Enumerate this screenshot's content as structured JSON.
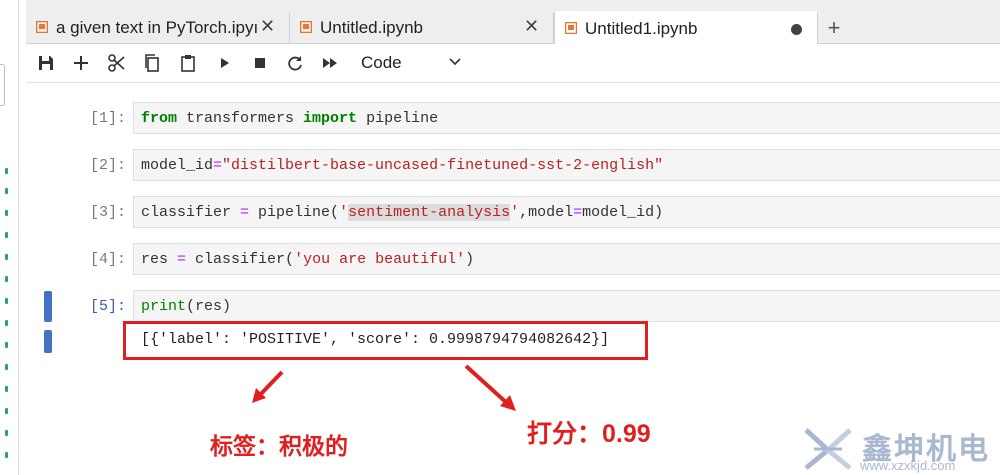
{
  "tabs": [
    {
      "label": "a given text in PyTorch.ipyı",
      "close": "✕",
      "active": false,
      "dirty": false
    },
    {
      "label": "Untitled.ipynb",
      "close": "✕",
      "active": false,
      "dirty": false
    },
    {
      "label": "Untitled1.ipynb",
      "close": "",
      "active": true,
      "dirty": true
    }
  ],
  "add_tab_label": "+",
  "toolbar": {
    "icons": [
      "save-icon",
      "add-cell-icon",
      "cut-icon",
      "copy-icon",
      "paste-icon",
      "run-icon",
      "stop-icon",
      "restart-icon",
      "fast-forward-icon"
    ],
    "cell_type": "Code"
  },
  "cells": [
    {
      "prompt": "[1]:",
      "parts": [
        {
          "t": "from",
          "c": "kw"
        },
        {
          "t": " transformers ",
          "c": ""
        },
        {
          "t": "import",
          "c": "kw"
        },
        {
          "t": " pipeline",
          "c": ""
        }
      ]
    },
    {
      "prompt": "[2]:",
      "parts": [
        {
          "t": "model_id",
          "c": ""
        },
        {
          "t": "=",
          "c": "eq"
        },
        {
          "t": "\"distilbert-base-uncased-finetuned-sst-2-english\"",
          "c": "str"
        }
      ]
    },
    {
      "prompt": "[3]:",
      "parts": [
        {
          "t": "classifier ",
          "c": ""
        },
        {
          "t": "=",
          "c": "eq"
        },
        {
          "t": " pipeline(",
          "c": ""
        },
        {
          "t": "'",
          "c": "str"
        },
        {
          "t": "sentiment-analysis",
          "c": "str hl"
        },
        {
          "t": "'",
          "c": "str"
        },
        {
          "t": ",model",
          "c": ""
        },
        {
          "t": "=",
          "c": "eq"
        },
        {
          "t": "model_id)",
          "c": ""
        }
      ]
    },
    {
      "prompt": "[4]:",
      "parts": [
        {
          "t": "res ",
          "c": ""
        },
        {
          "t": "=",
          "c": "eq"
        },
        {
          "t": " classifier(",
          "c": ""
        },
        {
          "t": "'you are beautiful'",
          "c": "str"
        },
        {
          "t": ")",
          "c": ""
        }
      ]
    },
    {
      "prompt": "[5]:",
      "parts": [
        {
          "t": "print",
          "c": "kw-light"
        },
        {
          "t": "(res)",
          "c": ""
        }
      ]
    }
  ],
  "output": "[{'label': 'POSITIVE', 'score': 0.9998794794082642}]",
  "annotations": {
    "label_note": "标签：积极的",
    "score_note": "打分：0.99"
  },
  "watermark": {
    "text": "鑫坤机电",
    "url": "www.xzxkjd.com"
  },
  "colors": {
    "accent": "#e02020",
    "selection": "#4472c4",
    "tab_icon": "#e8772e"
  }
}
